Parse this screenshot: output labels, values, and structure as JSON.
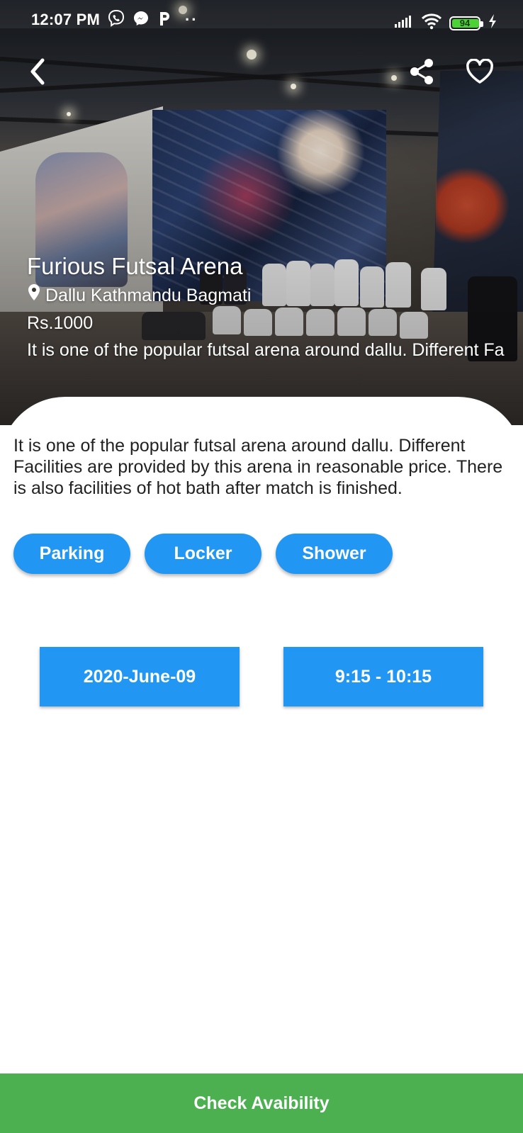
{
  "status_bar": {
    "time": "12:07 PM",
    "app_icons": [
      "viber-icon",
      "messenger-icon",
      "p-app-icon"
    ],
    "more_notifications": "··",
    "battery_level": "94",
    "battery_color": "#4cd137"
  },
  "venue": {
    "name": "Furious Futsal Arena",
    "location": "Dallu Kathmandu Bagmati",
    "price": "Rs.1000",
    "blurb": "It is one of the popular futsal arena around dallu. Different Fa"
  },
  "details": {
    "description": "It is one of the popular futsal arena around dallu. Different Facilities are provided by this arena in reasonable price. There is also facilities of hot bath after match is finished.",
    "facilities": [
      "Parking",
      "Locker",
      "Shower"
    ]
  },
  "booking": {
    "date": "2020-June-09",
    "time_slot": "9:15 - 10:15",
    "check_button": "Check Avaibility"
  },
  "colors": {
    "primary_blue": "#2196f3",
    "cta_green": "#4caf50"
  }
}
